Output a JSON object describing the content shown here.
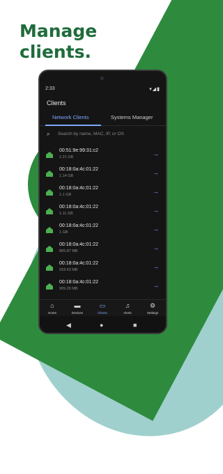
{
  "headline": [
    "Manage",
    "clients."
  ],
  "status_bar": {
    "time": "2:33"
  },
  "app": {
    "title": "Clients",
    "tabs": [
      {
        "label": "Network Clients",
        "active": true
      },
      {
        "label": "Systems Manager",
        "active": false
      }
    ],
    "search": {
      "placeholder": "Search by name, MAC, IP, or OS"
    },
    "clients": [
      {
        "mac": "00:51:9e:99:31:c2",
        "usage": "1.21 GB"
      },
      {
        "mac": "00:18:0a:4c:01:22",
        "usage": "1.14 GB"
      },
      {
        "mac": "00:18:0a:4c:01:22",
        "usage": "1.1 GB"
      },
      {
        "mac": "00:18:0a:4c:01:22",
        "usage": "1.11 GB"
      },
      {
        "mac": "00:18:0a:4c:01:22",
        "usage": "1 GB"
      },
      {
        "mac": "00:18:0a:4c:01:22",
        "usage": "865.87 MB"
      },
      {
        "mac": "00:18:0a:4c:01:22",
        "usage": "918.63 MB"
      },
      {
        "mac": "00:18:0a:4c:01:22",
        "usage": "909.29 MB"
      }
    ],
    "bottom_nav": [
      {
        "label": "Home",
        "icon": "home-icon"
      },
      {
        "label": "Devices",
        "icon": "devices-icon"
      },
      {
        "label": "Clients",
        "icon": "laptop-icon",
        "active": true
      },
      {
        "label": "Alerts",
        "icon": "bell-icon"
      },
      {
        "label": "Settings",
        "icon": "gear-icon"
      }
    ]
  },
  "colors": {
    "brand_green": "#1f6b3b",
    "accent_blue": "#7ea7ff",
    "client_icon_green": "#4caf50"
  }
}
